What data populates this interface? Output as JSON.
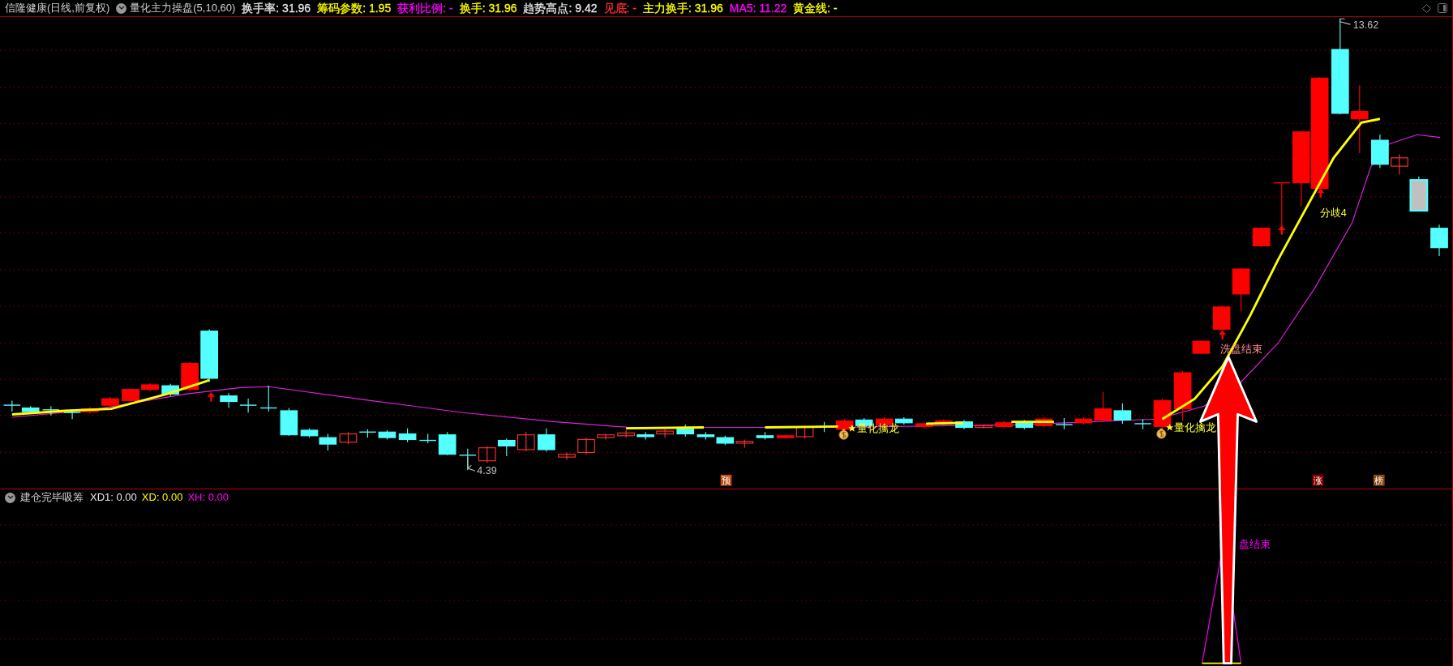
{
  "header": {
    "stock": "信隆健康(日线,前复权)",
    "indicator": "量化主力操盘(5,10,60)",
    "items": [
      {
        "text": "换手率: 31.96",
        "color": "#e6e6e6"
      },
      {
        "text": "筹码参数: 1.95",
        "color": "#ffff00"
      },
      {
        "text": "获利比例: -",
        "color": "#ff00ff"
      },
      {
        "text": "换手: 31.96",
        "color": "#ffff00"
      },
      {
        "text": "趋势高点: 9.42",
        "color": "#e6e6e6"
      },
      {
        "text": "见底: -",
        "color": "#ff3030"
      },
      {
        "text": "主力换手: 31.96",
        "color": "#ffff00"
      },
      {
        "text": "MA5: 11.22",
        "color": "#ff00ff"
      },
      {
        "text": "黄金线: -",
        "color": "#ffff00"
      }
    ]
  },
  "main_chart": {
    "high_label": "13.62",
    "low_label": "4.39",
    "signals": [
      {
        "text": "量化擒龙"
      },
      {
        "text": "量化擒龙"
      }
    ],
    "wash_end": "洗盘结束",
    "divergence": "分歧4",
    "badges": [
      {
        "text": "预",
        "color": "#c04a10"
      },
      {
        "text": "涨",
        "color": "#8b0000"
      },
      {
        "text": "榜",
        "color": "#8b4a10"
      }
    ]
  },
  "sub_chart": {
    "title": "建仓完毕吸筹",
    "items": [
      {
        "text": "XD1: 0.00",
        "color": "#e6e6e6"
      },
      {
        "text": "XD: 0.00",
        "color": "#ffff00"
      },
      {
        "text": "XH: 0.00",
        "color": "#ff00ff"
      }
    ],
    "signal": "盘结束"
  }
}
